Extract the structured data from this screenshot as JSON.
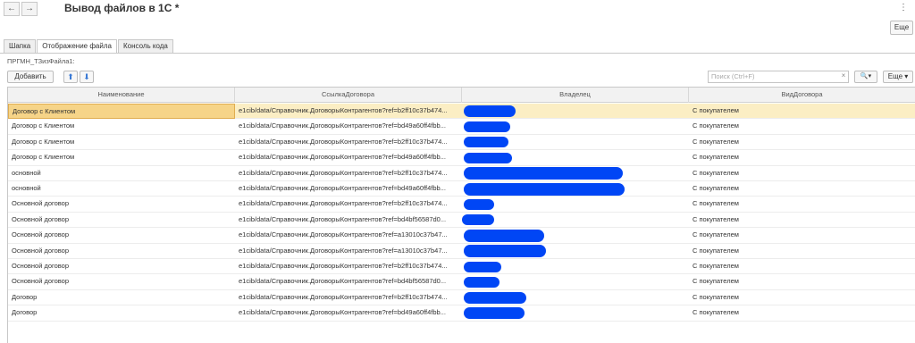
{
  "header": {
    "back_icon": "←",
    "forward_icon": "→",
    "title": "Вывод файлов в 1С *",
    "kebab_icon": "⋮",
    "more_label": "Еще"
  },
  "tabs": [
    {
      "label": "Шапка",
      "active": false
    },
    {
      "label": "Отображение файла",
      "active": true
    },
    {
      "label": "Консоль кода",
      "active": false
    }
  ],
  "section": {
    "field_label": "ПРГМН_ТЗизФайла1:",
    "add_label": "Добавить",
    "up_icon": "⬆",
    "down_icon": "⬇",
    "search_placeholder": "Поиск (Ctrl+F)",
    "search_clear": "×",
    "search_btn_icon": "🔍▾",
    "more_label": "Еще ▾"
  },
  "table": {
    "columns": [
      "Наименование",
      "СсылкаДоговора",
      "Владелец",
      "ВидДоговора"
    ],
    "rows": [
      {
        "name": "Договор с Клиентом",
        "ref": "e1cib/data/Справочник.ДоговорыКонтрагентов?ref=b2ff10c37b474...",
        "owner": "",
        "kind": "С покупателем"
      },
      {
        "name": "Договор с Клиентом",
        "ref": "e1cib/data/Справочник.ДоговорыКонтрагентов?ref=bd49a60ff4fbb...",
        "owner": "",
        "kind": "С покупателем"
      },
      {
        "name": "Договор с Клиентом",
        "ref": "e1cib/data/Справочник.ДоговорыКонтрагентов?ref=b2ff10c37b474...",
        "owner": "",
        "kind": "С покупателем"
      },
      {
        "name": "Договор с Клиентом",
        "ref": "e1cib/data/Справочник.ДоговорыКонтрагентов?ref=bd49a60ff4fbb...",
        "owner": "",
        "kind": "С покупателем"
      },
      {
        "name": "основной",
        "ref": "e1cib/data/Справочник.ДоговорыКонтрагентов?ref=b2ff10c37b474...",
        "owner": "",
        "kind": "С покупателем"
      },
      {
        "name": "основной",
        "ref": "e1cib/data/Справочник.ДоговорыКонтрагентов?ref=bd49a60ff4fbb...",
        "owner": "",
        "kind": "С покупателем"
      },
      {
        "name": "Основной договор",
        "ref": "e1cib/data/Справочник.ДоговорыКонтрагентов?ref=b2ff10c37b474...",
        "owner": "",
        "kind": "С покупателем"
      },
      {
        "name": "Основной договор",
        "ref": "e1cib/data/Справочник.ДоговорыКонтрагентов?ref=bd4bf56587d0...",
        "owner": "",
        "kind": "С покупателем"
      },
      {
        "name": "Основной договор",
        "ref": "e1cib/data/Справочник.ДоговорыКонтрагентов?ref=a13010c37b47...",
        "owner": "",
        "kind": "С покупателем"
      },
      {
        "name": "Основной договор",
        "ref": "e1cib/data/Справочник.ДоговорыКонтрагентов?ref=a13010c37b47...",
        "owner": "",
        "kind": "С покупателем"
      },
      {
        "name": "Основной договор",
        "ref": "e1cib/data/Справочник.ДоговорыКонтрагентов?ref=b2ff10c37b474...",
        "owner": "",
        "kind": "С покупателем"
      },
      {
        "name": "Основной договор",
        "ref": "e1cib/data/Справочник.ДоговорыКонтрагентов?ref=bd4bf56587d0...",
        "owner": "",
        "kind": "С покупателем"
      },
      {
        "name": "Договор",
        "ref": "e1cib/data/Справочник.ДоговорыКонтрагентов?ref=b2ff10c37b474...",
        "owner": "",
        "kind": "С покупателем"
      },
      {
        "name": "Договор",
        "ref": "e1cib/data/Справочник.ДоговорыКонтрагентов?ref=bd49a60ff4fbb...",
        "owner": "",
        "kind": "С покупателем"
      }
    ]
  },
  "colors": {
    "redaction": "#0046f5",
    "selection_row": "#fbeec4",
    "selection_cell": "#f6d488"
  }
}
